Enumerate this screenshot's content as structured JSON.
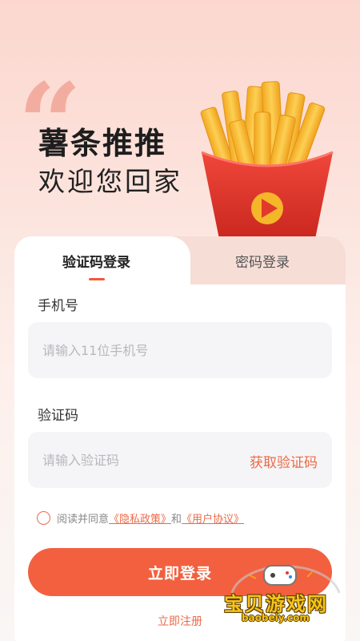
{
  "brand": {
    "title": "薯条推推",
    "subtitle": "欢迎您回家"
  },
  "tabs": {
    "active_label": "验证码登录",
    "inactive_label": "密码登录"
  },
  "phone": {
    "label": "手机号",
    "placeholder": "请输入11位手机号",
    "value": ""
  },
  "code": {
    "label": "验证码",
    "placeholder": "请输入验证码",
    "value": "",
    "get_code_label": "获取验证码"
  },
  "agreement": {
    "prefix": "阅读并同意",
    "privacy_link": "《隐私政策》",
    "conjunction": "和",
    "terms_link": "《用户协议》",
    "checked": false
  },
  "actions": {
    "login_label": "立即登录",
    "register_label": "立即注册"
  },
  "watermark": {
    "text": "宝贝游戏网",
    "url": "baobeiy.com"
  },
  "colors": {
    "accent": "#f2603f",
    "link": "#ec6a48",
    "fries_box": "#e23a30",
    "fries": "#f8c23c"
  }
}
